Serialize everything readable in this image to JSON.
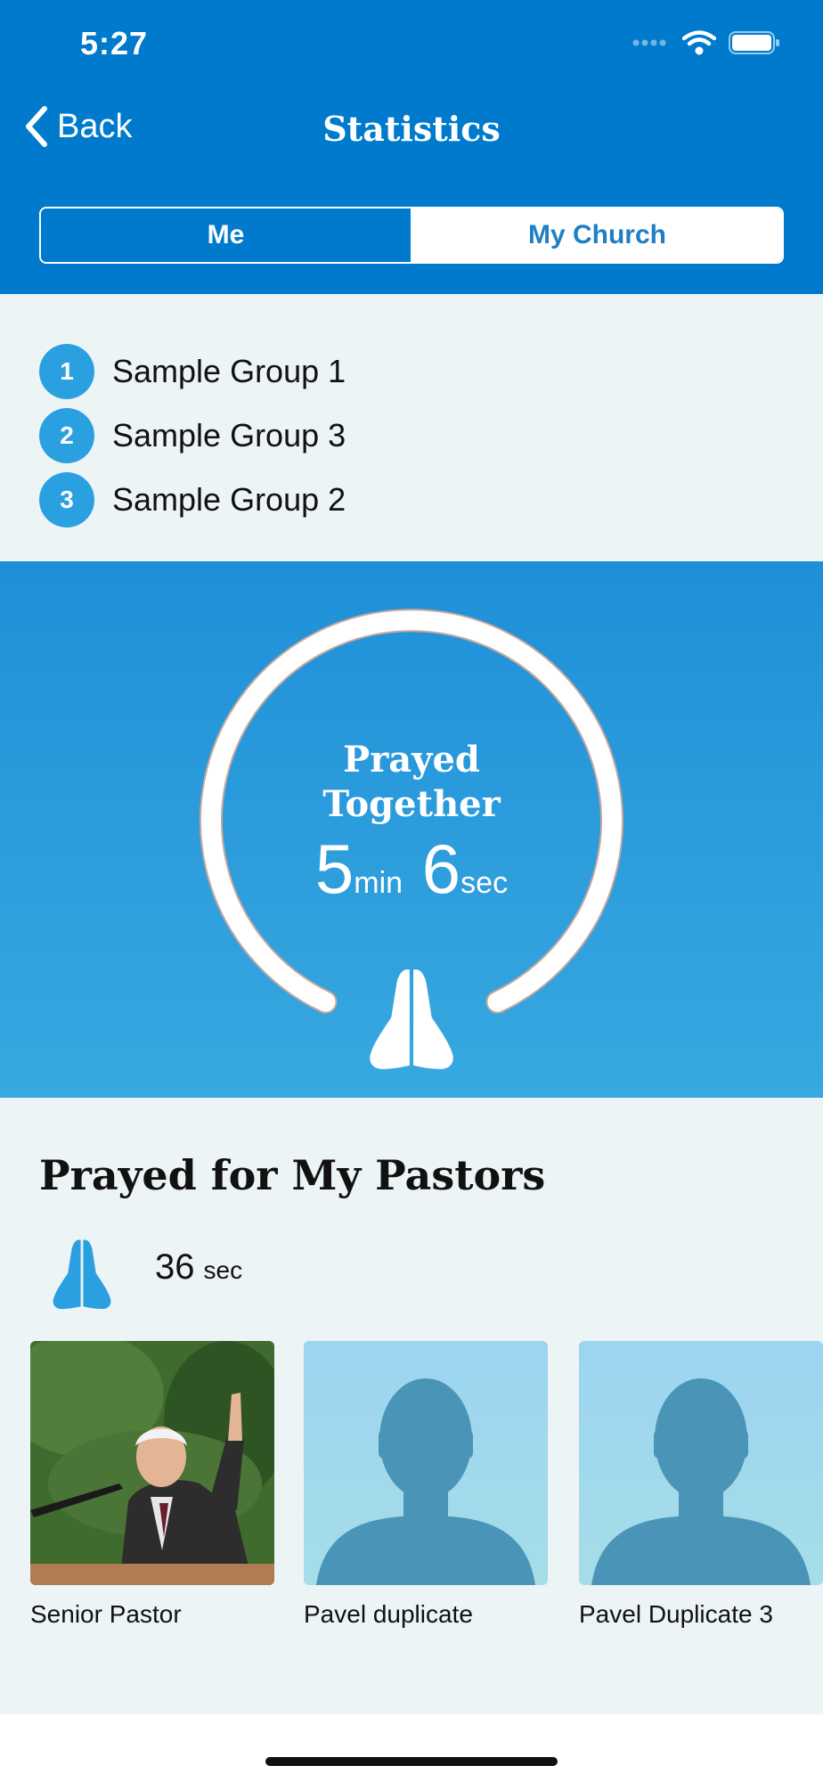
{
  "status_bar": {
    "time": "5:27"
  },
  "nav": {
    "back_label": "Back",
    "title": "Statistics"
  },
  "tabs": {
    "me": "Me",
    "my_church": "My Church",
    "selected": "me"
  },
  "groups": [
    {
      "rank": "1",
      "name": "Sample Group 1"
    },
    {
      "rank": "2",
      "name": "Sample Group 3"
    },
    {
      "rank": "3",
      "name": "Sample Group 2"
    }
  ],
  "prayed_together": {
    "title_line1": "Prayed",
    "title_line2": "Together",
    "minutes": "5",
    "minutes_unit": "min",
    "seconds": "6",
    "seconds_unit": "sec",
    "icon": "praying-hands-icon"
  },
  "pastors": {
    "title": "Prayed for My Pastors",
    "time_value": "36",
    "time_unit": "sec",
    "items": [
      {
        "name": "Senior Pastor",
        "photo": "pastor-photo"
      },
      {
        "name": "Pavel duplicate",
        "photo": "placeholder-avatar"
      },
      {
        "name": "Pavel Duplicate 3",
        "photo": "placeholder-avatar"
      }
    ]
  },
  "colors": {
    "header": "#007acc",
    "accent": "#2aa0e0",
    "banner_top": "#1f90d8",
    "banner_bottom": "#38a8e0",
    "background": "#edf4f6"
  }
}
